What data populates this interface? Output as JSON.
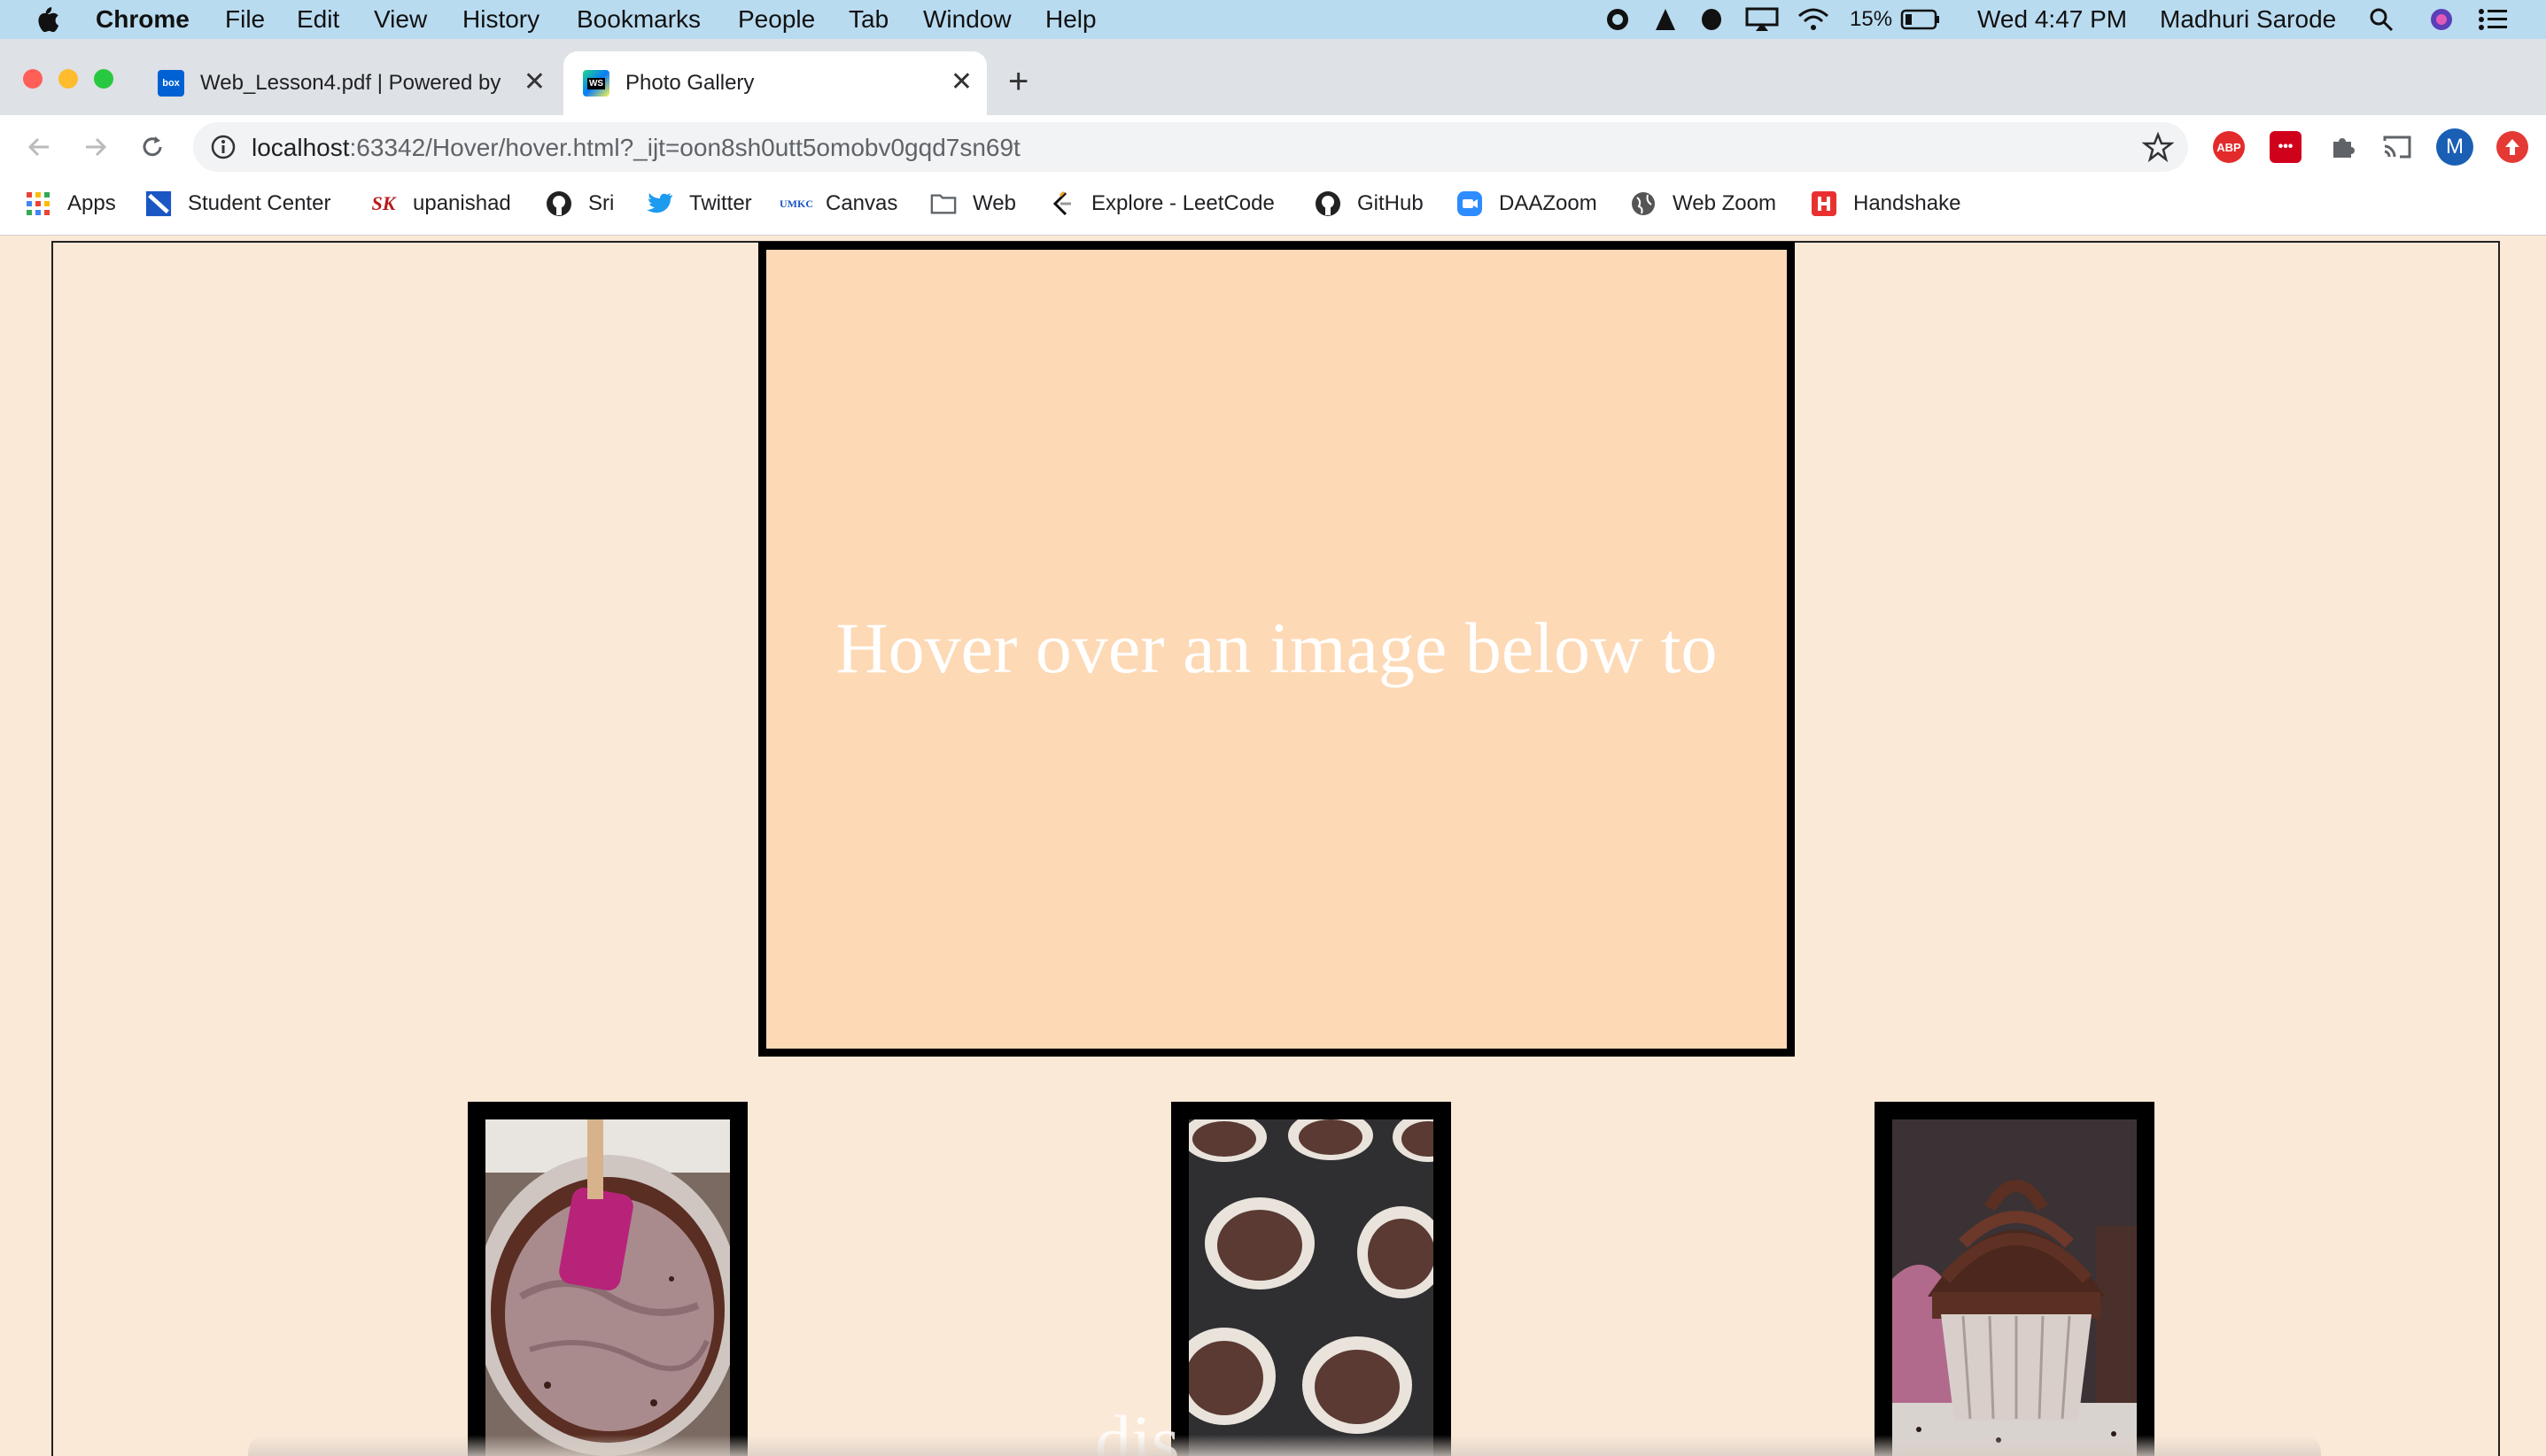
{
  "menubar": {
    "app": "Chrome",
    "items": [
      "File",
      "Edit",
      "View",
      "History",
      "Bookmarks",
      "People",
      "Tab",
      "Window",
      "Help"
    ],
    "battery": "15%",
    "datetime": "Wed 4:47 PM",
    "user": "Madhuri Sarode"
  },
  "tabs": [
    {
      "title": "Web_Lesson4.pdf | Powered by",
      "favicon": "box",
      "active": false
    },
    {
      "title": "Photo Gallery",
      "favicon": "WS",
      "active": true
    }
  ],
  "toolbar": {
    "url_host": "localhost",
    "url_path": ":63342/Hover/hover.html?_ijt=oon8sh0utt5omobv0gqd7sn69t",
    "profile_initial": "M",
    "abp_label": "ABP"
  },
  "bookmarks": [
    {
      "label": "Apps",
      "icon": "apps-grid-icon"
    },
    {
      "label": "Student Center",
      "icon": "student-center-icon"
    },
    {
      "label": "upanishad",
      "icon": "sk-icon",
      "glyph": "SK"
    },
    {
      "label": "Sri",
      "icon": "github-icon"
    },
    {
      "label": "Twitter",
      "icon": "twitter-icon"
    },
    {
      "label": "Canvas",
      "icon": "umkc-icon",
      "glyph": "UMKC"
    },
    {
      "label": "Web",
      "icon": "folder-icon"
    },
    {
      "label": "Explore - LeetCode",
      "icon": "leetcode-icon"
    },
    {
      "label": "GitHub",
      "icon": "github-icon"
    },
    {
      "label": "DAAZoom",
      "icon": "zoom-icon"
    },
    {
      "label": "Web Zoom",
      "icon": "globe-icon"
    },
    {
      "label": "Handshake",
      "icon": "handshake-icon"
    }
  ],
  "page": {
    "display_text": "Hover over an image below to",
    "ghost_text": "dis"
  },
  "colors": {
    "page_bg": "#fbe9d7",
    "display_bg": "#fdd9b5",
    "menubar_bg": "#b9dbf0"
  }
}
